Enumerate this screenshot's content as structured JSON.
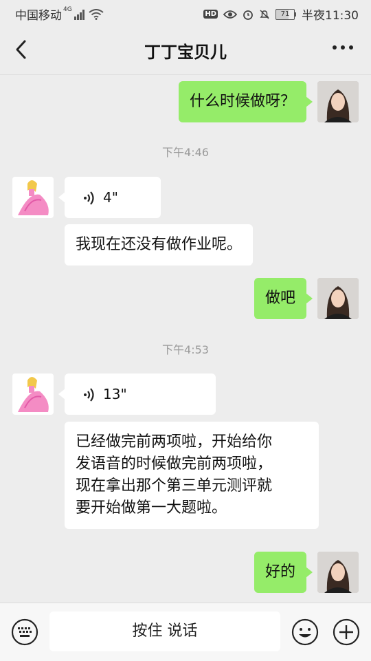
{
  "status_bar": {
    "carrier": "中国移动",
    "network": "4G",
    "battery": "71",
    "time": "半夜11:30"
  },
  "header": {
    "title": "丁丁宝贝儿"
  },
  "messages": [
    {
      "type": "text",
      "side": "right",
      "text": "什么时候做呀？"
    },
    {
      "type": "time",
      "text": "下午4:46"
    },
    {
      "type": "voice",
      "side": "left",
      "duration": "4\""
    },
    {
      "type": "text",
      "side": "left",
      "text": "我现在还没有做作业呢。"
    },
    {
      "type": "text",
      "side": "right",
      "text": "做吧"
    },
    {
      "type": "time",
      "text": "下午4:53"
    },
    {
      "type": "voice",
      "side": "left",
      "duration": "13\""
    },
    {
      "type": "text",
      "side": "left",
      "lines": [
        "已经做完前两项啦，开始给你",
        "发语音的时候做完前两项啦，",
        "现在拿出那个第三单元测评就",
        "要开始做第一大题啦。"
      ]
    },
    {
      "type": "text",
      "side": "right",
      "text": "好的"
    }
  ],
  "input_bar": {
    "hold_to_talk": "按住 说话"
  },
  "icons": {
    "back": "back-arrow-icon",
    "more": "more-dots-icon",
    "voice": "voice-wave-icon",
    "keyboard": "keyboard-icon",
    "emoji": "emoji-icon",
    "plus": "plus-icon"
  },
  "colors": {
    "background": "#ededed",
    "sent_bubble": "#95ec69",
    "received_bubble": "#ffffff"
  }
}
